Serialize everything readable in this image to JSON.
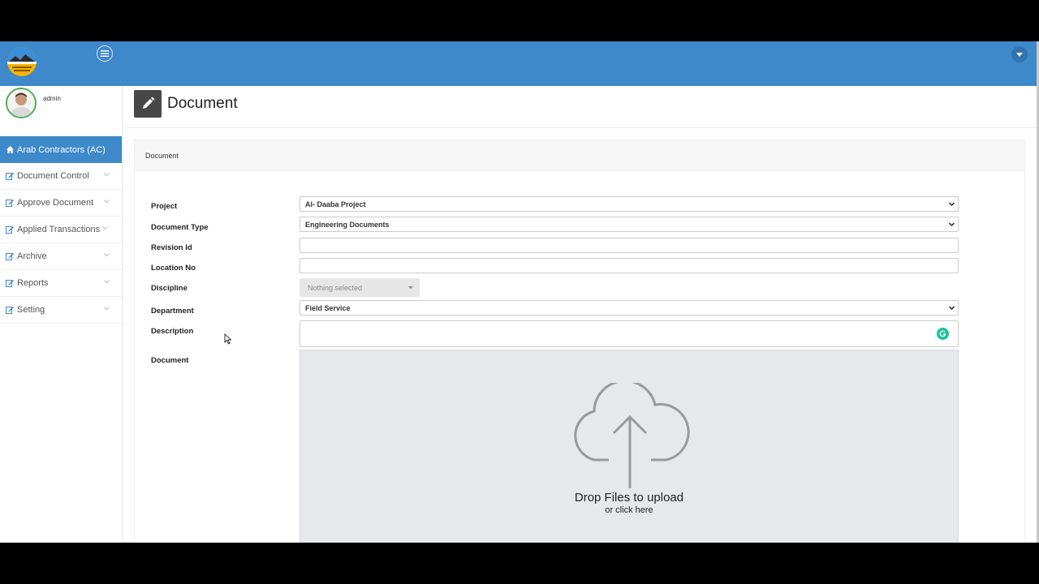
{
  "header": {
    "user_menu_icon": "caret-down-icon",
    "toggle_icon": "hamburger-icon"
  },
  "sidebar": {
    "user": {
      "name": "admin"
    },
    "items": [
      {
        "label": "Arab Contractors (AC)",
        "icon": "home-icon",
        "active": true
      },
      {
        "label": "Document Control",
        "icon": "edit-icon"
      },
      {
        "label": "Approve Document",
        "icon": "edit-icon"
      },
      {
        "label": "Applied Transactions",
        "icon": "edit-icon"
      },
      {
        "label": "Archive",
        "icon": "edit-icon"
      },
      {
        "label": "Reports",
        "icon": "edit-icon"
      },
      {
        "label": "Setting",
        "icon": "edit-icon"
      }
    ]
  },
  "page": {
    "title": "Document",
    "panel_heading": "Document"
  },
  "form": {
    "project": {
      "label": "Project",
      "value": "Al- Daaba Project"
    },
    "document_type": {
      "label": "Document Type",
      "value": "Engineering Documents"
    },
    "revision_id": {
      "label": "Revision Id",
      "value": ""
    },
    "location_no": {
      "label": "Location No",
      "value": ""
    },
    "discipline": {
      "label": "Discipline",
      "value": "Nothing selected"
    },
    "department": {
      "label": "Department",
      "value": "Field Service"
    },
    "description": {
      "label": "Description",
      "value": ""
    },
    "document": {
      "label": "Document",
      "drop_title": "Drop Files to upload",
      "drop_subtitle": "or click here"
    }
  },
  "colors": {
    "primary": "#3e89c9",
    "header_icon_bg": "#474747",
    "grammarly": "#15c39a"
  }
}
